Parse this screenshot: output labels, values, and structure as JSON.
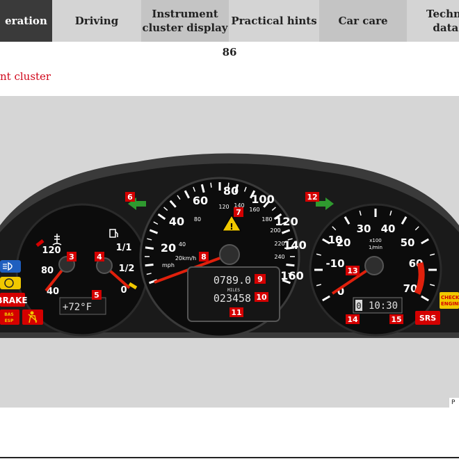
{
  "tabs": [
    {
      "label": "eration",
      "state": "active"
    },
    {
      "label": "Driving",
      "state": ""
    },
    {
      "label": "Instrument\ncluster display",
      "state": ""
    },
    {
      "label": "Practical hints",
      "state": ""
    },
    {
      "label": "Car care",
      "state": ""
    },
    {
      "label": "Techni\ndata",
      "state": ""
    }
  ],
  "page_number": "86",
  "section_title": "nt cluster",
  "figure": {
    "speed_mph_ticks": [
      "20",
      "40",
      "60",
      "80",
      "100",
      "120",
      "140",
      "160"
    ],
    "speed_kmh_ticks": [
      "40",
      "80",
      "120",
      "140",
      "160",
      "180",
      "200",
      "220",
      "240"
    ],
    "speed_mph_label": "mph",
    "speed_kmh_label": "20km/h",
    "rpm_ticks": [
      "-10",
      "0",
      "10",
      "20",
      "30",
      "40",
      "50",
      "60",
      "70"
    ],
    "rpm_unit_top": "x100",
    "rpm_unit_bottom": "1/min",
    "temp_ticks": [
      "40",
      "80",
      "120"
    ],
    "fuel_ticks": [
      "0",
      "1/2",
      "1/1"
    ],
    "outside_temp": "+72°F",
    "trip_odometer": "0789.0",
    "odometer_label": "MILES",
    "odometer": "023458",
    "clock_digit": "0",
    "clock": "10:30",
    "warning_brake": "BRAKE",
    "warning_bas": "BAS\nESP",
    "warning_check_engine": "CHECK\nENGINE",
    "warning_srs": "SRS",
    "callouts": [
      "3",
      "4",
      "5",
      "6",
      "7",
      "8",
      "9",
      "10",
      "11",
      "12",
      "13",
      "14",
      "15"
    ],
    "figure_code": "P"
  },
  "colors": {
    "active_tab": "#3a3a3a",
    "accent_red": "#d0061a",
    "figure_bg": "#d6d6d6",
    "warning_red": "#d40000",
    "warning_yellow": "#f0c800",
    "indicator_green": "#2f9a2f",
    "needle_red": "#e0200c"
  }
}
